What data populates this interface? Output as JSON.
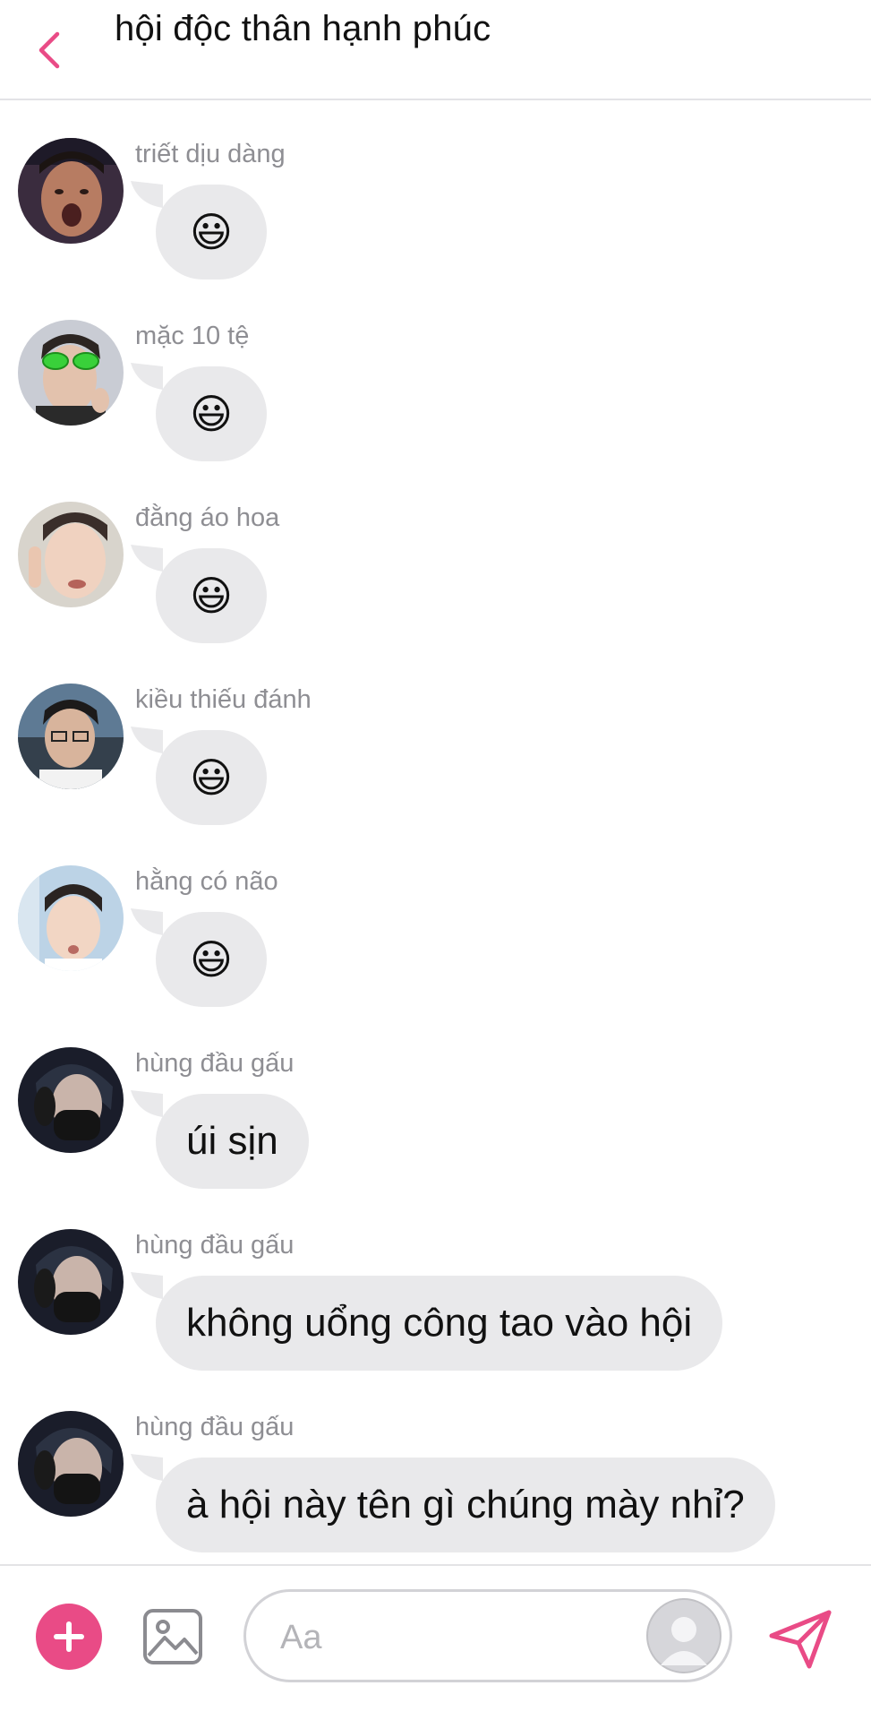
{
  "header": {
    "title": "hội độc thân hạnh phúc",
    "back_icon": "chevron-left-icon"
  },
  "colors": {
    "accent": "#e94b86",
    "bubble": "#e9e9eb",
    "sender_text": "#8e8e93",
    "divider": "#e3e3e6"
  },
  "messages": [
    {
      "sender": "triết dịu dàng",
      "text": "😃",
      "is_emoji": true
    },
    {
      "sender": "mặc 10 tệ",
      "text": "😃",
      "is_emoji": true
    },
    {
      "sender": "đằng áo hoa",
      "text": "😃",
      "is_emoji": true
    },
    {
      "sender": "kiều thiếu đánh",
      "text": "😃",
      "is_emoji": true
    },
    {
      "sender": "hằng có não",
      "text": "😃",
      "is_emoji": true
    },
    {
      "sender": "hùng đầu gấu",
      "text": "úi sịn",
      "is_emoji": false
    },
    {
      "sender": "hùng đầu gấu",
      "text": "không uổng công tao vào hội",
      "is_emoji": false
    },
    {
      "sender": "hùng đầu gấu",
      "text": "à hội này tên gì chúng mày nhỉ?",
      "is_emoji": false
    }
  ],
  "composer": {
    "placeholder": "Aa",
    "value": "",
    "add_icon": "plus-circle-icon",
    "image_icon": "image-icon",
    "sticker_icon": "profile-sticker-icon",
    "send_icon": "send-icon"
  }
}
